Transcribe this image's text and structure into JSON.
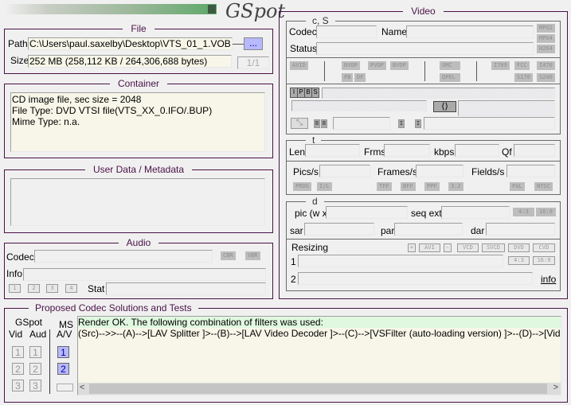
{
  "app": {
    "logo": "GSpot"
  },
  "file": {
    "title": "File",
    "path_label": "Path",
    "path_value": "C:\\Users\\paul.saxelby\\Desktop\\VTS_01_1.VOB",
    "browse_label": "...",
    "size_label": "Size",
    "size_value": "252 MB (258,112 KB / 264,306,688 bytes)",
    "page": "1/1"
  },
  "container": {
    "title": "Container",
    "lines": [
      "CD image file, sec size = 2048",
      "File Type: DVD VTSI file(VTS_XX_0.IFO/.BUP)",
      "Mime Type: n.a."
    ]
  },
  "userdata": {
    "title": "User Data / Metadata"
  },
  "audio": {
    "title": "Audio",
    "codec_label": "Codec",
    "cbr": "CBR",
    "vbr": "VBR",
    "info_label": "Info",
    "streams": [
      "1",
      "2",
      "3",
      "4"
    ],
    "stat_label": "Stat"
  },
  "video": {
    "title": "Video",
    "cs_title": "c, S",
    "codec_label": "Codec",
    "name_label": "Name",
    "status_label": "Status",
    "fmt_tags": [
      "MPG2",
      "MPG4",
      "H264"
    ],
    "avid": "AVID",
    "vop_tags": [
      "NVOP",
      "PVOP",
      "BVOP",
      "PB",
      "DF"
    ],
    "gmc": "GMC",
    "qpel": "QPEL",
    "color_tags": [
      "I709",
      "FCC",
      "I470",
      "S170",
      "S240"
    ],
    "frame_types": [
      "I",
      "P",
      "B",
      "S"
    ],
    "bb": [
      "B",
      "B"
    ],
    "ii": [
      "I",
      "I"
    ],
    "t_title": "t",
    "len_label": "Len",
    "frms_label": "Frms",
    "kbps_label": "kbps",
    "qf_label": "Qf",
    "pics_label": "Pics/s",
    "frames_label": "Frames/s",
    "fields_label": "Fields/s",
    "scan_tags": [
      "PROG",
      "I/L",
      "TFF",
      "BFF",
      "PPF",
      "3:2",
      "PAL",
      "NTSC"
    ],
    "d_title": "d",
    "pic_label": "pic (w x",
    "seq_label": "seq ext",
    "ar_tags": [
      "4:3",
      "16:9"
    ],
    "sar_label": "sar",
    "par_label": "par",
    "dar_label": "dar",
    "resizing_label": "Resizing",
    "resize_buttons": [
      "+",
      "AVI",
      "-",
      "VCD",
      "SVCD",
      "DVD",
      "CVD"
    ],
    "row1": "1",
    "row2": "2",
    "ar2_buttons": [
      "4:3",
      "16:9"
    ],
    "info_link": "info"
  },
  "codec": {
    "title": "Proposed Codec Solutions and Tests",
    "gspot_label": "GSpot",
    "vid_label": "Vid",
    "aud_label": "Aud",
    "ms_label": "MS",
    "av_label": "A/V",
    "buttons": [
      "1",
      "2",
      "3"
    ],
    "result_line1": "Render OK. The following combination of filters was used:",
    "result_line2": "(Src)-->>--(A)-->[LAV Splitter ]>--(B)-->[LAV Video Decoder ]>--(C)-->[VSFilter (auto-loading version) ]>--(D)-->[Video Renderer ]"
  }
}
